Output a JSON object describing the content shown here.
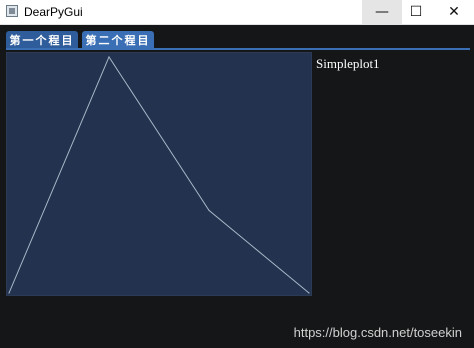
{
  "window": {
    "title": "DearPyGui",
    "controls": {
      "minimize": "—",
      "maximize": "☐",
      "close": "✕"
    }
  },
  "tabs": [
    {
      "label": "第一个程目"
    },
    {
      "label": "第二个程目"
    }
  ],
  "plot": {
    "label": "Simpleplot1"
  },
  "watermark": "https://blog.csdn.net/toseekin",
  "chart_data": {
    "type": "line",
    "x": [
      0,
      1,
      2,
      3
    ],
    "y": [
      0,
      1,
      0.35,
      0
    ],
    "xlim": [
      0,
      3
    ],
    "ylim": [
      0,
      1
    ],
    "line_color": "#a9b7c6",
    "background": "#22324f",
    "grid": false
  }
}
